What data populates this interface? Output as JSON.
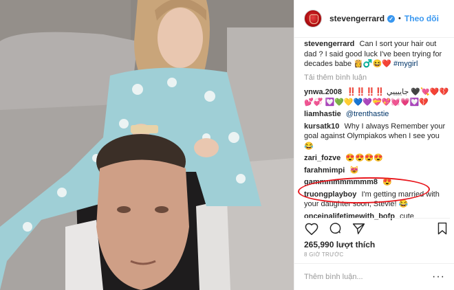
{
  "post": {
    "username": "stevengerrard",
    "follow_label": "Theo dõi",
    "dot": "•",
    "verified_glyph": "✓"
  },
  "caption": {
    "username": "stevengerrard",
    "text": "Can I sort your hair out dad ? I said good luck I've been trying for decades babe",
    "emoji": "👸♂️😆❤️",
    "hashtag": "#mygirl"
  },
  "load_more_label": "Tải thêm bình luận",
  "comments": [
    {
      "username": "ynwa.2008",
      "text": "‼️‼️‼️‼️ جاييييي 🖤💘❤️💔💕💞",
      "emoji": "💟💚💛💙💜💝💖💓💗💟💔"
    },
    {
      "username": "liamhastie",
      "text": "@trenthastie",
      "emoji": ""
    },
    {
      "username": "kursatk10",
      "text": "Why I always Remember your goal against Olympiakos when I see you",
      "emoji": "😂"
    },
    {
      "username": "zari_fozve",
      "text": "",
      "emoji": "😍😍😍😍"
    },
    {
      "username": "farahmimpi",
      "text": "",
      "emoji": "😻"
    },
    {
      "username": "gammmmmmmmm8",
      "text": "",
      "emoji": "😍"
    },
    {
      "username": "truongplayboy",
      "text": "I'm getting married with your daughter soon, Stevie!",
      "emoji": "😂"
    },
    {
      "username": "onceinalifetimewith_bofp",
      "text": "cute",
      "emoji": ""
    }
  ],
  "actions": {
    "like_icon": "heart-icon",
    "comment_icon": "comment-icon",
    "share_icon": "share-icon",
    "save_icon": "bookmark-icon"
  },
  "likes_label": "265,990 lượt thích",
  "time_label": "8 GIỜ TRƯỚC",
  "comment_input": {
    "placeholder": "Thêm bình luận..."
  },
  "more_label": "···",
  "colors": {
    "accent_blue": "#3897f0",
    "highlight_red": "#e8161c",
    "muted": "#999999"
  }
}
